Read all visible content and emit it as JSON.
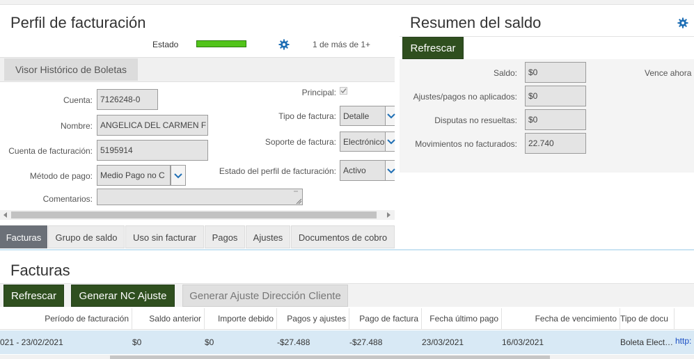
{
  "perfil": {
    "title": "Perfil de facturación",
    "estado_label": "Estado",
    "estado_color": "#52c41a",
    "pager": "1 de más de 1+",
    "visor_button": "Visor Histórico de Boletas",
    "fields": {
      "cuenta_label": "Cuenta:",
      "cuenta_value": "7126248-0",
      "nombre_label": "Nombre:",
      "nombre_value": "ANGELICA DEL CARMEN F",
      "cuenta_fact_label": "Cuenta de facturación:",
      "cuenta_fact_value": "5195914",
      "metodo_label": "Método de pago:",
      "metodo_value": "Medio Pago no C",
      "comentarios_label": "Comentarios:",
      "comentarios_value": "",
      "principal_label": "Principal:",
      "principal_checked": true,
      "tipo_label": "Tipo de factura:",
      "tipo_value": "Detalle",
      "soporte_label": "Soporte de factura:",
      "soporte_value": "Electrónico",
      "estado_perfil_label": "Estado del perfil de facturación:",
      "estado_perfil_value": "Activo"
    }
  },
  "tabs": [
    "Facturas",
    "Grupo de saldo",
    "Uso sin facturar",
    "Pagos",
    "Ajustes",
    "Documentos de cobro"
  ],
  "resumen": {
    "title": "Resumen del saldo",
    "refresh_label": "Refrescar",
    "saldo_label": "Saldo:",
    "saldo_value": "$0",
    "vence_label": "Vence ahora",
    "ajustes_label": "Ajustes/pagos no aplicados:",
    "ajustes_value": "$0",
    "disputas_label": "Disputas no resueltas:",
    "disputas_value": "$0",
    "movimientos_label": "Movimientos no facturados:",
    "movimientos_value": "22.740"
  },
  "facturas": {
    "title": "Facturas",
    "refresh_label": "Refrescar",
    "nc_label": "Generar NC Ajuste",
    "ajuste_dir_label": "Generar Ajuste Dirección Cliente",
    "columns": [
      "Período de facturación",
      "Saldo anterior",
      "Importe debido",
      "Pagos y ajustes",
      "Pago de factura",
      "Fecha último pago",
      "Fecha de vencimiento",
      "Tipo de docu"
    ],
    "rows": [
      [
        "021 - 23/02/2021",
        "$0",
        "$0",
        "-$27.488",
        "-$27.488",
        "23/03/2021",
        "16/03/2021",
        "Boleta Elect…",
        "http:"
      ]
    ]
  },
  "colors": {
    "accent_green": "#2f4f1f",
    "active_tab": "#6b7078",
    "row_highlight": "#d8e9f5",
    "gear_blue": "#1f6fb5"
  }
}
